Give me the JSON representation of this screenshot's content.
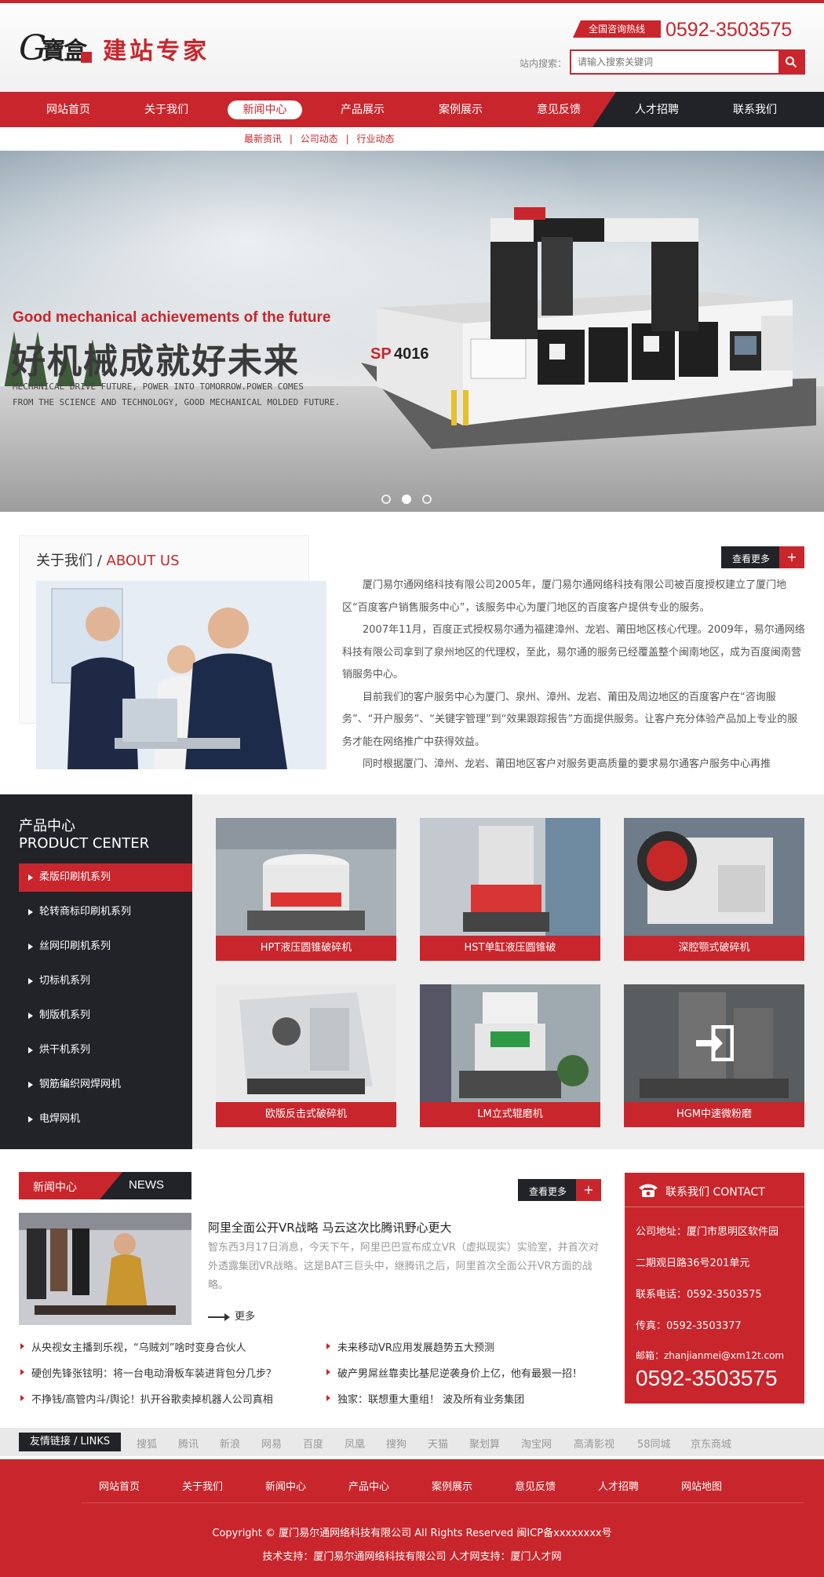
{
  "header": {
    "logo_letter": "G",
    "logo_name": "寶盒",
    "logo_slogan": "建站专家",
    "hotline_label": "全国咨询热线",
    "hotline_phone": "0592-3503575",
    "search_label": "站内搜索：",
    "search_placeholder": "请输入搜索关键词"
  },
  "nav": {
    "items": [
      {
        "label": "网站首页"
      },
      {
        "label": "关于我们"
      },
      {
        "label": "新闻中心",
        "active": true
      },
      {
        "label": "产品展示"
      },
      {
        "label": "案例展示"
      },
      {
        "label": "意见反馈"
      },
      {
        "label": "人才招聘"
      },
      {
        "label": "联系我们"
      }
    ],
    "subnav": [
      "最新资讯",
      "公司动态",
      "行业动态"
    ],
    "subnav_sep": "|"
  },
  "banner": {
    "headline_en": "Good mechanical achievements of the future",
    "headline_cn": "好机械成就好未来",
    "sub_line1": "MECHANICAL DRIVE FUTURE, POWER INTO TOMORROW.POWER COMES",
    "sub_line2": "FROM THE SCIENCE AND TECHNOLOGY, GOOD MECHANICAL MOLDED FUTURE.",
    "machine_model": "SP 4016",
    "slides": 3,
    "active_slide": 2
  },
  "about": {
    "title_cn": "关于我们 /",
    "title_en": "ABOUT US",
    "more_label": "查看更多",
    "more_plus": "+",
    "paragraphs": [
      "厦门易尔通网络科技有限公司2005年，厦门易尔通网络科技有限公司被百度授权建立了厦门地区“百度客户销售服务中心”，该服务中心为厦门地区的百度客户提供专业的服务。",
      "2007年11月，百度正式授权易尔通为福建漳州、龙岩、莆田地区核心代理。2009年，易尔通网络科技有限公司拿到了泉州地区的代理权，至此，易尔通的服务已经覆盖整个闽南地区，成为百度闽南营销服务中心。",
      "目前我们的客户服务中心为厦门、泉州、漳州、龙岩、莆田及周边地区的百度客户在“咨询服务”、“开户服务”、“关键字管理”到“效果跟踪报告”方面提供服务。让客户充分体验产品加上专业的服务才能在网络推广中获得效益。",
      "同时根据厦门、漳州、龙岩、莆田地区客户对服务更高质量的要求易尔通客户服务中心再推"
    ]
  },
  "products": {
    "title_cn": "产品中心",
    "title_en": "PRODUCT CENTER",
    "categories": [
      {
        "label": "柔版印刷机系列",
        "active": true
      },
      {
        "label": "轮转商标印刷机系列"
      },
      {
        "label": "丝网印刷机系列"
      },
      {
        "label": "切标机系列"
      },
      {
        "label": "制版机系列"
      },
      {
        "label": "烘干机系列"
      },
      {
        "label": "钢筋编织网焊网机"
      },
      {
        "label": "电焊网机"
      }
    ],
    "items": [
      {
        "name": "HPT液压圆锥破碎机"
      },
      {
        "name": "HST单缸液压圆锥破"
      },
      {
        "name": "深腔颚式破碎机"
      },
      {
        "name": "欧版反击式破碎机"
      },
      {
        "name": "LM立式辊磨机"
      },
      {
        "name": "HGM中速微粉磨"
      }
    ]
  },
  "news": {
    "title_cn": "新闻中心",
    "title_en": "NEWS",
    "more_label": "查看更多",
    "more_plus": "+",
    "featured_title": "阿里全面公开VR战略 马云这次比腾讯野心更大",
    "featured_summary": "智东西3月17日消息，今天下午，阿里巴巴宣布成立VR（虚拟现实）实验室，并首次对外透露集团VR战略。这是BAT三巨头中，继腾讯之后，阿里首次全面公开VR方面的战略。",
    "featured_more": "更多",
    "list": [
      "从央视女主播到乐视，“乌贼刘”啥时变身合伙人",
      "未来移动VR应用发展趋势五大预测",
      "硬创先锋张铉明：将一台电动滑板车装进背包分几步？",
      "破产男屌丝靠卖比基尼逆袭身价上亿，他有最狠一招！",
      "不挣钱/高管内斗/舆论！扒开谷歌卖掉机器人公司真相",
      "独家：联想重大重组！ 波及所有业务集团"
    ]
  },
  "contact": {
    "title": "联系我们 CONTACT",
    "address_label": "公司地址：厦门市思明区软件园",
    "address_line2": "二期观日路36号201单元",
    "phone": "联系电话：0592-3503575",
    "fax": "传真：0592-3503377",
    "email": "邮箱：zhanjianmei@xm12t.com",
    "big_phone": "0592-3503575"
  },
  "links": {
    "label": "友情链接 / LINKS",
    "items": [
      "搜狐",
      "腾讯",
      "新浪",
      "网易",
      "百度",
      "凤凰",
      "搜狗",
      "天猫",
      "聚划算",
      "淘宝网",
      "高清影视",
      "58同城",
      "京东商城"
    ]
  },
  "footer": {
    "nav": [
      "网站首页",
      "关于我们",
      "新闻中心",
      "产品中心",
      "案例展示",
      "意见反馈",
      "人才招聘",
      "网站地图"
    ],
    "copyright": "Copyright © 厦门易尔通网络科技有限公司 All Rights Reserved 闽ICP备xxxxxxxx号",
    "tech": "技术支持：厦门易尔通网络科技有限公司 人才网支持：厦门人才网"
  },
  "colors": {
    "accent": "#c8262c",
    "dark": "#222328"
  }
}
